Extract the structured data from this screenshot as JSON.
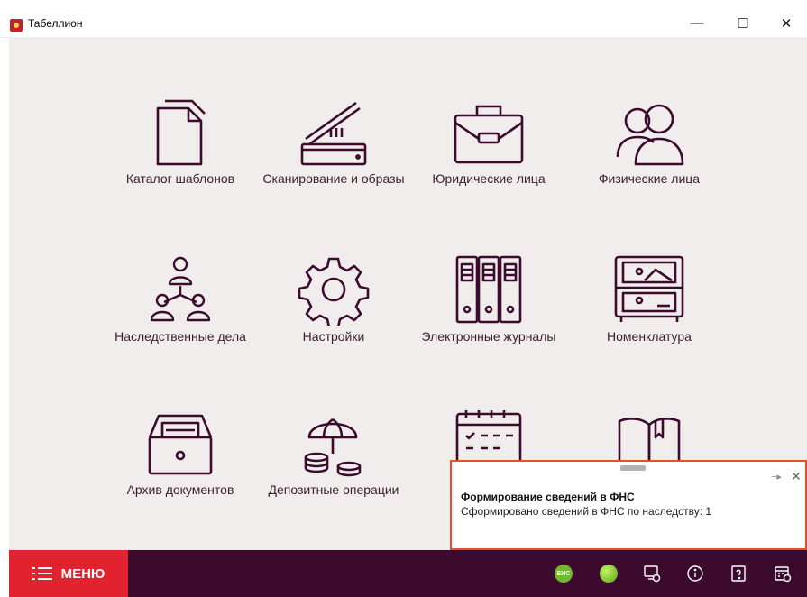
{
  "window": {
    "title": "Табеллион"
  },
  "tiles": [
    {
      "label": "Каталог шаблонов",
      "icon": "document-icon"
    },
    {
      "label": "Сканирование и образы",
      "icon": "scanner-icon"
    },
    {
      "label": "Юридические лица",
      "icon": "briefcase-icon"
    },
    {
      "label": "Физические лица",
      "icon": "people-icon"
    },
    {
      "label": "Наследственные дела",
      "icon": "hierarchy-people-icon"
    },
    {
      "label": "Настройки",
      "icon": "gear-icon"
    },
    {
      "label": "Электронные журналы",
      "icon": "binders-icon"
    },
    {
      "label": "Номенклатура",
      "icon": "cabinet-icon"
    },
    {
      "label": "Архив документов",
      "icon": "archive-box-icon"
    },
    {
      "label": "Депозитные операции",
      "icon": "umbrella-coins-icon"
    },
    {
      "label": "",
      "icon": "calendar-icon"
    },
    {
      "label": "",
      "icon": "book-icon"
    }
  ],
  "bottombar": {
    "menu_label": "МЕНЮ",
    "eis_label": "ЕИС",
    "icons": [
      "status-green-icon",
      "remote-screen-icon",
      "info-icon",
      "help-icon",
      "calendar-clock-icon"
    ]
  },
  "notification": {
    "title": "Формирование сведений в ФНС",
    "text": "Сформировано сведений в ФНС по наследству: 1"
  },
  "colors": {
    "accent": "#e0232e",
    "dark": "#3b0a2c",
    "icon": "#3a0b2c",
    "toast_border": "#e2512a"
  }
}
